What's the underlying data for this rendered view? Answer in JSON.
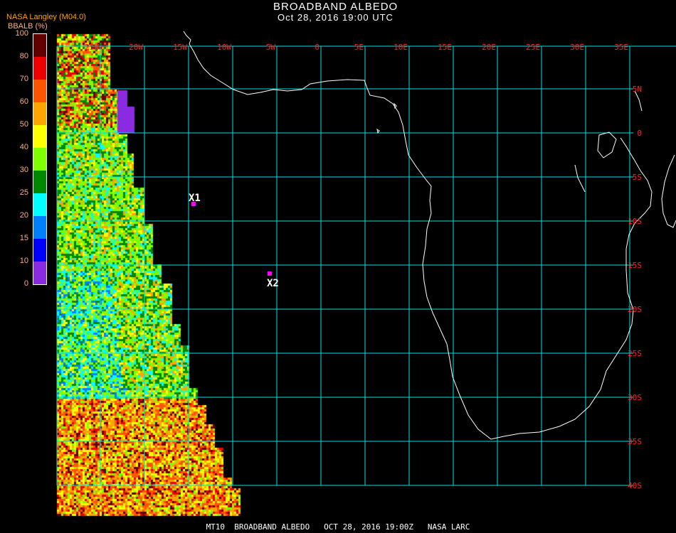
{
  "header": {
    "title": "BROADBAND ALBEDO",
    "subtitle": "Oct 28, 2016 19:00 UTC",
    "source": "NASA Langley (M04.0)"
  },
  "legend": {
    "label": "BBALB (%)",
    "ticks": [
      "100",
      "80",
      "70",
      "60",
      "50",
      "40",
      "30",
      "25",
      "20",
      "15",
      "10",
      "0"
    ],
    "colors": [
      "#600000",
      "#ee0000",
      "#ff5500",
      "#ffa500",
      "#ffff00",
      "#80ff00",
      "#008800",
      "#00ffff",
      "#0080ff",
      "#0000ff",
      "#8a2be2"
    ]
  },
  "map": {
    "lon_labels": [
      "25W",
      "20W",
      "15W",
      "10W",
      "5W",
      "0",
      "5E",
      "10E",
      "15E",
      "20E",
      "25E",
      "30E",
      "35E"
    ],
    "lat_labels": [
      "5N",
      "0",
      "5S",
      "10S",
      "15S",
      "20S",
      "25S",
      "30S",
      "35S",
      "40S"
    ],
    "grid_color": "#00e0e0",
    "markers": [
      {
        "label": "X1",
        "color": "#ff00ff"
      },
      {
        "label": "X2",
        "color": "#ff00ff"
      }
    ]
  },
  "footer": "MT10  BROADBAND ALBEDO   OCT 28, 2016 19:00Z   NASA LARC"
}
